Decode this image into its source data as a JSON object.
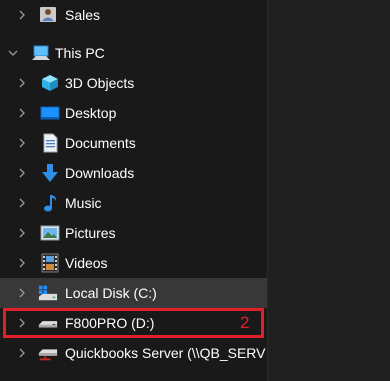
{
  "tree": {
    "sales": {
      "label": "Sales",
      "icon": "user-folder-icon"
    },
    "this_pc": {
      "label": "This PC",
      "icon": "computer-icon"
    },
    "objects_3d": {
      "label": "3D Objects",
      "icon": "cube-3d-icon"
    },
    "desktop": {
      "label": "Desktop",
      "icon": "desktop-icon"
    },
    "documents": {
      "label": "Documents",
      "icon": "documents-icon"
    },
    "downloads": {
      "label": "Downloads",
      "icon": "download-icon"
    },
    "music": {
      "label": "Music",
      "icon": "music-note-icon"
    },
    "pictures": {
      "label": "Pictures",
      "icon": "pictures-icon"
    },
    "videos": {
      "label": "Videos",
      "icon": "film-icon"
    },
    "local_disk": {
      "label": "Local Disk (C:)",
      "icon": "windows-drive-icon"
    },
    "f800pro": {
      "label": "F800PRO (D:)",
      "icon": "drive-icon"
    },
    "quickbooks": {
      "label": "Quickbooks Server (\\\\QB_SERV",
      "icon": "network-drive-icon"
    }
  },
  "annotation": {
    "step": "2"
  },
  "colors": {
    "background": "#191919",
    "selected_row": "#383838",
    "highlight": "#e0202a",
    "text": "#ffffff"
  }
}
